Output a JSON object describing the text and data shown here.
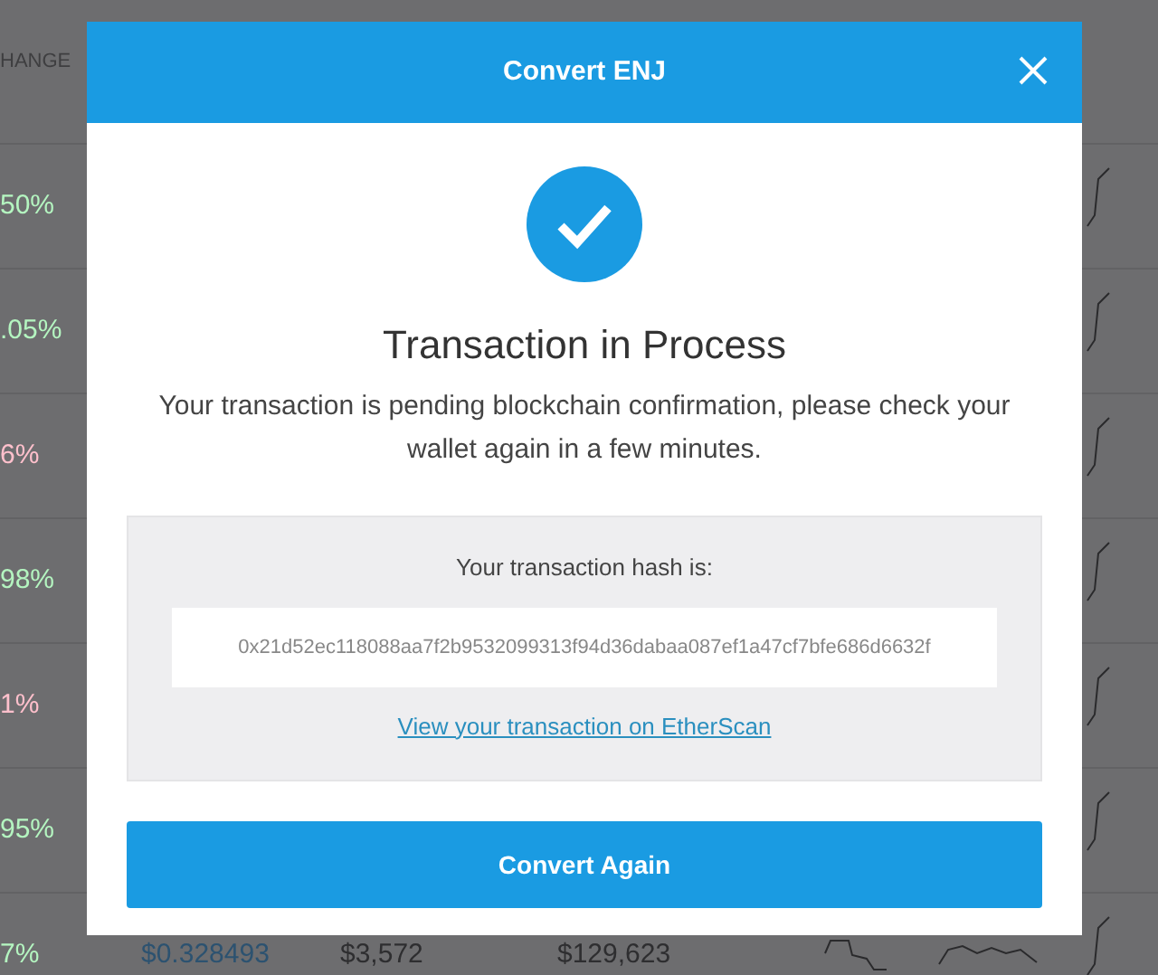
{
  "background_table": {
    "header": "HANGE",
    "rows": [
      {
        "change": "50%",
        "color": "#b4f5c0"
      },
      {
        "change": ".05%",
        "color": "#b4f5c0"
      },
      {
        "change": "6%",
        "color": "#ffc0cc"
      },
      {
        "change": "98%",
        "color": "#b4f5c0"
      },
      {
        "change": "1%",
        "color": "#ffc0cc"
      },
      {
        "change": "95%",
        "color": "#b4f5c0"
      },
      {
        "change": "7%",
        "color": "#b4f5c0",
        "price": "$0.328493",
        "volume": "$3,572",
        "market_cap": "$129,623"
      }
    ]
  },
  "modal": {
    "title": "Convert ENJ",
    "heading": "Transaction in Process",
    "message": "Your transaction is pending blockchain confirmation, please check your wallet again in a few minutes.",
    "hash_label": "Your transaction hash is:",
    "hash": "0x21d52ec118088aa7f2b9532099313f94d36dabaa087ef1a47cf7bfe686d6632f",
    "link": "View your transaction on EtherScan",
    "button": "Convert Again"
  }
}
